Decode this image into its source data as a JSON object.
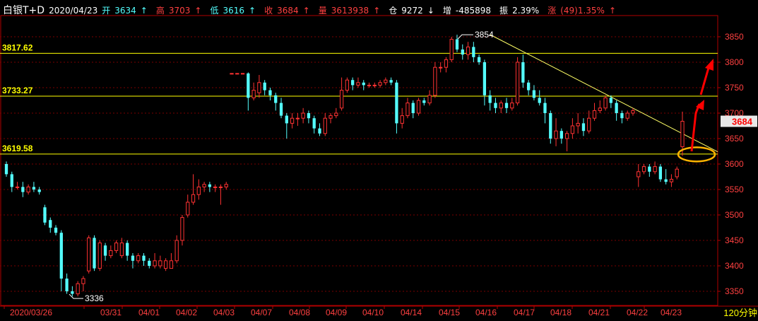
{
  "header": {
    "symbol": "白银T+D",
    "date": "2020/04/23",
    "open_label": "开",
    "open": "3634",
    "high_label": "高",
    "high": "3703",
    "low_label": "低",
    "low": "3616",
    "close_label": "收",
    "close": "3684",
    "volume_label": "量",
    "volume": "3613938",
    "oi_label": "仓",
    "oi": "9272",
    "delta_label": "增",
    "delta": "-485898",
    "amp_label": "振",
    "amp": "2.39%",
    "chg_label": "涨",
    "chg": "(49)1.35%",
    "up_arrow": "↑",
    "down_arrow": "↓"
  },
  "period_label": "120分钟",
  "colors": {
    "up": "#ff3232",
    "down": "#54ffff",
    "level": "#ffff00",
    "trend": "#ffff66",
    "grid": "#7a0000",
    "axis": "#b00000",
    "ellipse": "#ffb400",
    "arrow": "#ff0000"
  },
  "chart_data": {
    "type": "candlestick",
    "ylim": [
      3316,
      3880
    ],
    "y_ticks": [
      "3850",
      "3800",
      "3750",
      "3700",
      "3650",
      "3600",
      "3550",
      "3500",
      "3450",
      "3400",
      "3350"
    ],
    "x_labels": [
      "2020/03/26",
      "03/31",
      "04/01",
      "04/02",
      "04/03",
      "04/07",
      "04/08",
      "04/09",
      "04/10",
      "04/14",
      "04/15",
      "04/16",
      "04/17",
      "04/18",
      "04/21",
      "04/22",
      "04/23"
    ],
    "levels": [
      {
        "label": "3817.62",
        "value": 3817.62
      },
      {
        "label": "3733.27",
        "value": 3733.27
      },
      {
        "label": "3619.58",
        "value": 3619.58
      }
    ],
    "current_price": "3684",
    "annotations": [
      {
        "text": "3854",
        "value": 3854
      },
      {
        "text": "3336",
        "value": 3336
      }
    ],
    "candles": [
      [
        3600,
        3580,
        3605,
        3575
      ],
      [
        3580,
        3555,
        3585,
        3545
      ],
      [
        3555,
        3555,
        3565,
        3550
      ],
      [
        3555,
        3545,
        3565,
        3535
      ],
      [
        3545,
        3555,
        3560,
        3540
      ],
      [
        3555,
        3550,
        3565,
        3545
      ],
      [
        3550,
        3545,
        3555,
        3540
      ],
      [
        3515,
        3485,
        3520,
        3480
      ],
      [
        3490,
        3475,
        3495,
        3465
      ],
      [
        3475,
        3465,
        3480,
        3460
      ],
      [
        3465,
        3375,
        3470,
        3350
      ],
      [
        3375,
        3350,
        3385,
        3345
      ],
      [
        3350,
        3345,
        3360,
        3340
      ],
      [
        3345,
        3365,
        3370,
        3340
      ],
      [
        3365,
        3375,
        3380,
        3350
      ],
      [
        3390,
        3455,
        3460,
        3385
      ],
      [
        3455,
        3395,
        3460,
        3390
      ],
      [
        3395,
        3445,
        3450,
        3390
      ],
      [
        3440,
        3420,
        3445,
        3410
      ],
      [
        3420,
        3430,
        3440,
        3415
      ],
      [
        3430,
        3445,
        3450,
        3425
      ],
      [
        3420,
        3445,
        3455,
        3415
      ],
      [
        3445,
        3420,
        3450,
        3410
      ],
      [
        3420,
        3410,
        3425,
        3395
      ],
      [
        3410,
        3420,
        3425,
        3405
      ],
      [
        3420,
        3410,
        3425,
        3400
      ],
      [
        3410,
        3400,
        3415,
        3395
      ],
      [
        3400,
        3410,
        3425,
        3395
      ],
      [
        3400,
        3410,
        3420,
        3395
      ],
      [
        3395,
        3410,
        3415,
        3390
      ],
      [
        3395,
        3410,
        3425,
        3395
      ],
      [
        3410,
        3450,
        3460,
        3405
      ],
      [
        3450,
        3495,
        3500,
        3440
      ],
      [
        3500,
        3525,
        3540,
        3495
      ],
      [
        3525,
        3540,
        3580,
        3520
      ],
      [
        3540,
        3555,
        3570,
        3530
      ],
      [
        3555,
        3560,
        3565,
        3545
      ],
      [
        3560,
        3555,
        3565,
        3545
      ],
      [
        3555,
        3555,
        3560,
        3545
      ],
      [
        3555,
        3555,
        3560,
        3520
      ],
      [
        3555,
        3560,
        3565,
        3550
      ],
      [
        3778,
        3778,
        3778,
        3778
      ],
      [
        3778,
        3778,
        3778,
        3778
      ],
      [
        3778,
        3778,
        3778,
        3778
      ],
      [
        3778,
        3730,
        3780,
        3705
      ],
      [
        3730,
        3745,
        3760,
        3725
      ],
      [
        3740,
        3760,
        3775,
        3730
      ],
      [
        3760,
        3745,
        3765,
        3735
      ],
      [
        3745,
        3735,
        3750,
        3725
      ],
      [
        3735,
        3720,
        3740,
        3705
      ],
      [
        3720,
        3695,
        3730,
        3690
      ],
      [
        3695,
        3680,
        3700,
        3650
      ],
      [
        3680,
        3690,
        3700,
        3670
      ],
      [
        3690,
        3690,
        3700,
        3675
      ],
      [
        3690,
        3700,
        3710,
        3680
      ],
      [
        3700,
        3690,
        3705,
        3680
      ],
      [
        3690,
        3670,
        3695,
        3660
      ],
      [
        3670,
        3660,
        3680,
        3655
      ],
      [
        3660,
        3690,
        3700,
        3655
      ],
      [
        3690,
        3695,
        3700,
        3680
      ],
      [
        3695,
        3700,
        3710,
        3690
      ],
      [
        3710,
        3745,
        3770,
        3705
      ],
      [
        3745,
        3765,
        3770,
        3740
      ],
      [
        3765,
        3755,
        3770,
        3745
      ],
      [
        3755,
        3760,
        3770,
        3750
      ],
      [
        3760,
        3755,
        3765,
        3745
      ],
      [
        3755,
        3755,
        3760,
        3750
      ],
      [
        3755,
        3755,
        3760,
        3750
      ],
      [
        3755,
        3760,
        3765,
        3750
      ],
      [
        3760,
        3765,
        3770,
        3755
      ],
      [
        3765,
        3760,
        3770,
        3755
      ],
      [
        3760,
        3680,
        3765,
        3660
      ],
      [
        3680,
        3695,
        3710,
        3670
      ],
      [
        3695,
        3720,
        3730,
        3690
      ],
      [
        3720,
        3700,
        3725,
        3690
      ],
      [
        3700,
        3725,
        3730,
        3695
      ],
      [
        3725,
        3720,
        3730,
        3715
      ],
      [
        3720,
        3735,
        3745,
        3715
      ],
      [
        3735,
        3790,
        3800,
        3730
      ],
      [
        3790,
        3790,
        3800,
        3780
      ],
      [
        3790,
        3805,
        3810,
        3780
      ],
      [
        3805,
        3845,
        3850,
        3800
      ],
      [
        3845,
        3825,
        3854,
        3820
      ],
      [
        3825,
        3815,
        3835,
        3805
      ],
      [
        3815,
        3830,
        3840,
        3805
      ],
      [
        3830,
        3810,
        3840,
        3800
      ],
      [
        3810,
        3800,
        3815,
        3795
      ],
      [
        3800,
        3735,
        3805,
        3715
      ],
      [
        3735,
        3720,
        3745,
        3705
      ],
      [
        3720,
        3710,
        3730,
        3700
      ],
      [
        3710,
        3720,
        3725,
        3700
      ],
      [
        3720,
        3710,
        3730,
        3700
      ],
      [
        3710,
        3720,
        3730,
        3705
      ],
      [
        3720,
        3800,
        3810,
        3715
      ],
      [
        3800,
        3760,
        3815,
        3750
      ],
      [
        3760,
        3745,
        3765,
        3735
      ],
      [
        3745,
        3730,
        3755,
        3725
      ],
      [
        3730,
        3720,
        3745,
        3715
      ],
      [
        3720,
        3700,
        3730,
        3680
      ],
      [
        3700,
        3650,
        3705,
        3640
      ],
      [
        3650,
        3665,
        3690,
        3635
      ],
      [
        3665,
        3650,
        3670,
        3640
      ],
      [
        3650,
        3660,
        3665,
        3625
      ],
      [
        3660,
        3675,
        3690,
        3650
      ],
      [
        3675,
        3680,
        3700,
        3660
      ],
      [
        3680,
        3665,
        3690,
        3655
      ],
      [
        3665,
        3690,
        3705,
        3660
      ],
      [
        3690,
        3705,
        3720,
        3685
      ],
      [
        3705,
        3710,
        3725,
        3700
      ],
      [
        3710,
        3730,
        3735,
        3705
      ],
      [
        3730,
        3720,
        3735,
        3710
      ],
      [
        3720,
        3700,
        3725,
        3685
      ],
      [
        3700,
        3690,
        3705,
        3680
      ],
      [
        3690,
        3700,
        3705,
        3685
      ],
      [
        3700,
        3705,
        3710,
        3695
      ],
      [
        3575,
        3585,
        3600,
        3555
      ],
      [
        3585,
        3595,
        3600,
        3580
      ],
      [
        3595,
        3585,
        3600,
        3575
      ],
      [
        3585,
        3595,
        3605,
        3580
      ],
      [
        3595,
        3570,
        3600,
        3565
      ],
      [
        3570,
        3565,
        3590,
        3560
      ],
      [
        3565,
        3570,
        3580,
        3555
      ],
      [
        3575,
        3590,
        3595,
        3570
      ],
      [
        3634,
        3684,
        3703,
        3616
      ]
    ]
  }
}
